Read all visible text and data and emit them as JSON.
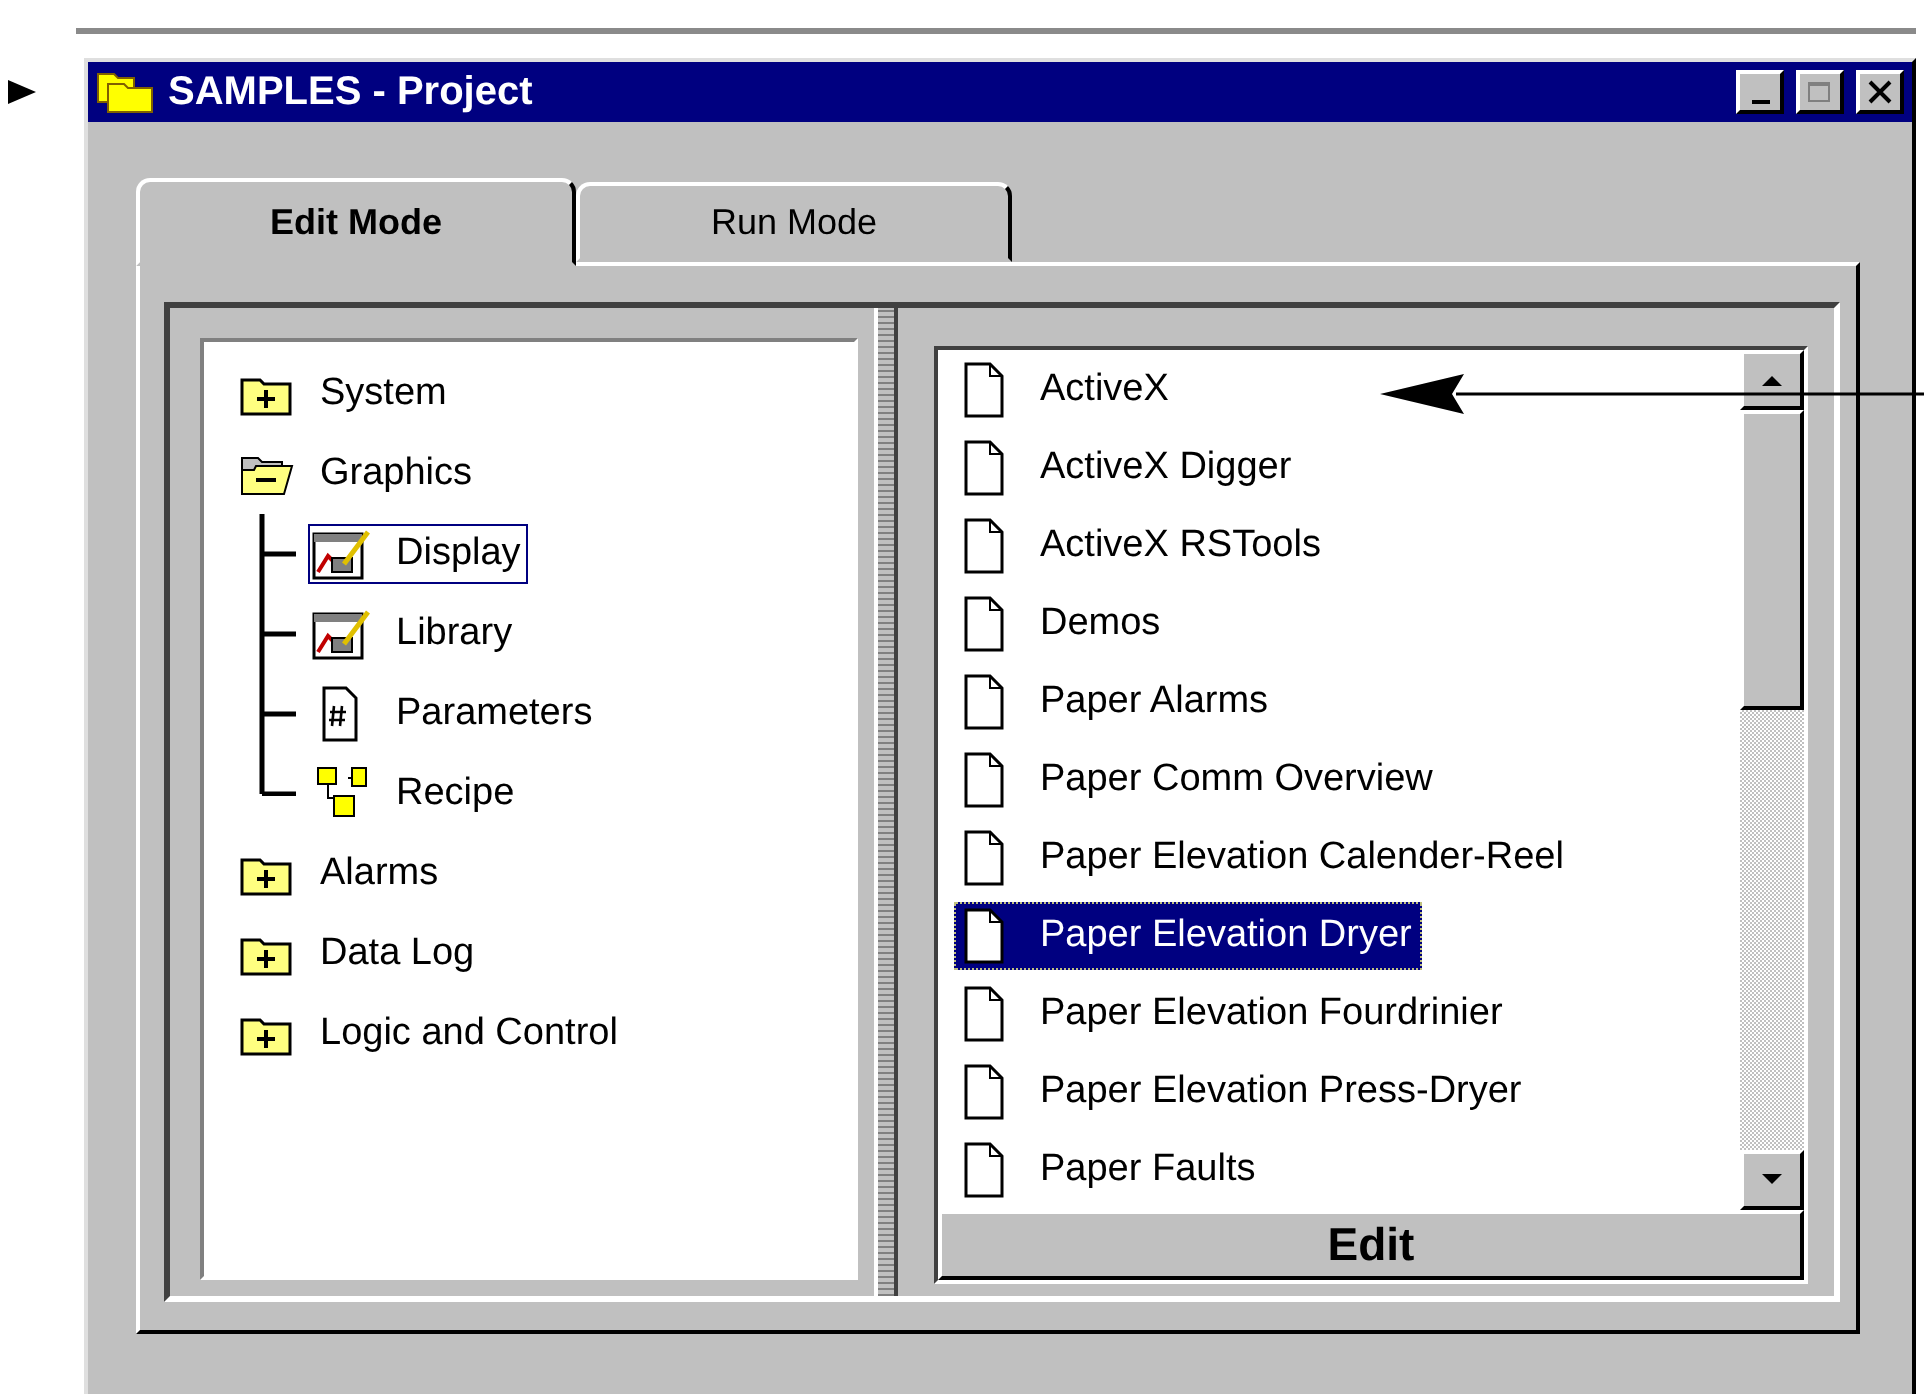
{
  "window": {
    "title": "SAMPLES - Project"
  },
  "tabs": [
    {
      "label": "Edit Mode",
      "selected": true
    },
    {
      "label": "Run Mode",
      "selected": false
    }
  ],
  "tree": [
    {
      "label": "System",
      "kind": "folder",
      "expanded": false,
      "selected": false
    },
    {
      "label": "Graphics",
      "kind": "folder",
      "expanded": true,
      "selected": false,
      "children": [
        {
          "label": "Display",
          "kind": "display",
          "selected": true
        },
        {
          "label": "Library",
          "kind": "display",
          "selected": false
        },
        {
          "label": "Parameters",
          "kind": "parameters",
          "selected": false
        },
        {
          "label": "Recipe",
          "kind": "recipe",
          "selected": false
        }
      ]
    },
    {
      "label": "Alarms",
      "kind": "folder",
      "expanded": false,
      "selected": false
    },
    {
      "label": "Data Log",
      "kind": "folder",
      "expanded": false,
      "selected": false
    },
    {
      "label": "Logic and Control",
      "kind": "folder",
      "expanded": false,
      "selected": false
    }
  ],
  "list": {
    "items": [
      {
        "label": "ActiveX",
        "selected": false
      },
      {
        "label": "ActiveX Digger",
        "selected": false
      },
      {
        "label": "ActiveX RSTools",
        "selected": false
      },
      {
        "label": "Demos",
        "selected": false
      },
      {
        "label": "Paper Alarms",
        "selected": false
      },
      {
        "label": "Paper Comm Overview",
        "selected": false
      },
      {
        "label": "Paper Elevation Calender-Reel",
        "selected": false
      },
      {
        "label": "Paper Elevation Dryer",
        "selected": true
      },
      {
        "label": "Paper Elevation Fourdrinier",
        "selected": false
      },
      {
        "label": "Paper Elevation Press-Dryer",
        "selected": false
      },
      {
        "label": "Paper Faults",
        "selected": false
      }
    ],
    "button": "Edit"
  }
}
